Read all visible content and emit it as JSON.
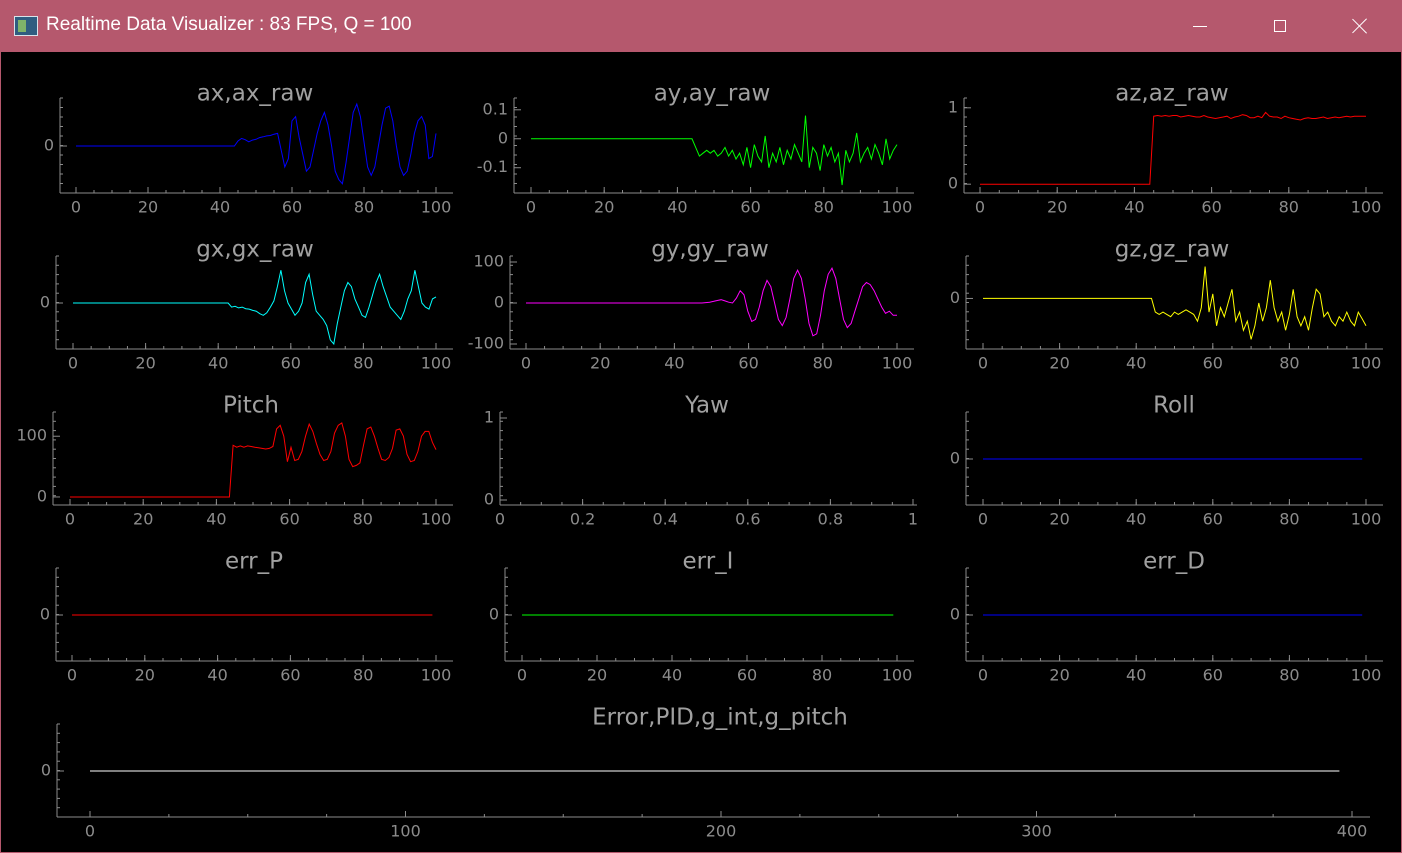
{
  "window": {
    "title": "Realtime Data Visualizer : 83 FPS, Q = 100",
    "icon": "app-chart-icon",
    "controls": [
      "minimize-icon",
      "maximize-icon",
      "close-icon"
    ]
  },
  "colors": {
    "background": "#000000",
    "titlebar": "#b5586d",
    "axis": "#8c8c8c",
    "title_text": "#a0a0a0"
  },
  "chart_data": [
    {
      "id": "ax",
      "type": "line",
      "title": "ax,ax_raw",
      "xlim": [
        0,
        100
      ],
      "ylim": [
        -1,
        1
      ],
      "xticks": [
        0,
        20,
        40,
        60,
        80,
        100
      ],
      "yticks": [
        0
      ],
      "series": [
        {
          "color": "#0000ff",
          "values": [
            0,
            0,
            0,
            0,
            0,
            0,
            0,
            0,
            0,
            0,
            0,
            0,
            0,
            0,
            0,
            0,
            0,
            0,
            0,
            0,
            0,
            0,
            0,
            0,
            0,
            0,
            0,
            0,
            0,
            0,
            0,
            0,
            0,
            0,
            0,
            0,
            0,
            0,
            0,
            0,
            0,
            0,
            0,
            0,
            0,
            0.12,
            0.18,
            0.15,
            0.1,
            0.14,
            0.16,
            0.2,
            0.22,
            0.24,
            0.25,
            0.28,
            0.3,
            -0.1,
            -0.5,
            -0.3,
            0.6,
            0.7,
            0.2,
            -0.2,
            -0.6,
            -0.5,
            -0.1,
            0.3,
            0.6,
            0.8,
            0.5,
            0,
            -0.6,
            -0.8,
            -0.9,
            -0.4,
            0.2,
            0.8,
            1.0,
            0.7,
            0.1,
            -0.5,
            -0.7,
            -0.5,
            0,
            0.5,
            0.9,
            0.95,
            0.6,
            0,
            -0.5,
            -0.7,
            -0.6,
            -0.2,
            0.3,
            0.6,
            0.7,
            0.5,
            -0.3,
            -0.25,
            0.3
          ]
        }
      ]
    },
    {
      "id": "ay",
      "type": "line",
      "title": "ay,ay_raw",
      "xlim": [
        0,
        100
      ],
      "ylim": [
        -0.17,
        0.12
      ],
      "xticks": [
        0,
        20,
        40,
        60,
        80,
        100
      ],
      "yticks": [
        0.1,
        0,
        -0.1
      ],
      "ytick_labels": [
        "0.1",
        "0",
        "-0.1"
      ],
      "series": [
        {
          "color": "#00ff00",
          "values": [
            0,
            0,
            0,
            0,
            0,
            0,
            0,
            0,
            0,
            0,
            0,
            0,
            0,
            0,
            0,
            0,
            0,
            0,
            0,
            0,
            0,
            0,
            0,
            0,
            0,
            0,
            0,
            0,
            0,
            0,
            0,
            0,
            0,
            0,
            0,
            0,
            0,
            0,
            0,
            0,
            0,
            0,
            0,
            0,
            0,
            -0.03,
            -0.06,
            -0.05,
            -0.04,
            -0.05,
            -0.04,
            -0.06,
            -0.05,
            -0.03,
            -0.06,
            -0.04,
            -0.07,
            -0.05,
            -0.09,
            -0.03,
            -0.1,
            -0.02,
            -0.06,
            -0.08,
            0.01,
            -0.1,
            -0.05,
            -0.08,
            -0.03,
            -0.09,
            -0.04,
            -0.07,
            -0.02,
            -0.05,
            -0.08,
            0.08,
            -0.1,
            -0.03,
            -0.05,
            -0.11,
            -0.02,
            -0.06,
            -0.03,
            -0.08,
            -0.05,
            -0.16,
            -0.04,
            -0.08,
            -0.05,
            0.02,
            -0.08,
            -0.05,
            -0.03,
            -0.07,
            -0.02,
            -0.05,
            -0.09,
            0,
            -0.07,
            -0.04,
            -0.02
          ]
        }
      ]
    },
    {
      "id": "az",
      "type": "line",
      "title": "az,az_raw",
      "xlim": [
        0,
        100
      ],
      "ylim": [
        -0.05,
        1.05
      ],
      "xticks": [
        0,
        20,
        40,
        60,
        80,
        100
      ],
      "yticks": [
        1,
        0
      ],
      "series": [
        {
          "color": "#ff0000",
          "values": [
            0,
            0,
            0,
            0,
            0,
            0,
            0,
            0,
            0,
            0,
            0,
            0,
            0,
            0,
            0,
            0,
            0,
            0,
            0,
            0,
            0,
            0,
            0,
            0,
            0,
            0,
            0,
            0,
            0,
            0,
            0,
            0,
            0,
            0,
            0,
            0,
            0,
            0,
            0,
            0,
            0,
            0,
            0,
            0,
            0,
            0.89,
            0.9,
            0.89,
            0.9,
            0.89,
            0.9,
            0.9,
            0.88,
            0.89,
            0.9,
            0.89,
            0.88,
            0.88,
            0.9,
            0.88,
            0.87,
            0.86,
            0.87,
            0.88,
            0.89,
            0.86,
            0.88,
            0.89,
            0.91,
            0.9,
            0.87,
            0.87,
            0.89,
            0.87,
            0.94,
            0.89,
            0.88,
            0.88,
            0.86,
            0.89,
            0.87,
            0.86,
            0.85,
            0.84,
            0.86,
            0.87,
            0.86,
            0.86,
            0.87,
            0.88,
            0.86,
            0.87,
            0.88,
            0.87,
            0.88,
            0.89,
            0.88,
            0.89,
            0.89,
            0.89,
            0.89
          ]
        }
      ]
    },
    {
      "id": "gx",
      "type": "line",
      "title": "gx,gx_raw",
      "xlim": [
        0,
        100
      ],
      "ylim": [
        -1,
        1
      ],
      "xticks": [
        0,
        20,
        40,
        60,
        80,
        100
      ],
      "yticks": [
        0
      ],
      "series": [
        {
          "color": "#00ffff",
          "values": [
            0,
            0,
            0,
            0,
            0,
            0,
            0,
            0,
            0,
            0,
            0,
            0,
            0,
            0,
            0,
            0,
            0,
            0,
            0,
            0,
            0,
            0,
            0,
            0,
            0,
            0,
            0,
            0,
            0,
            0,
            0,
            0,
            0,
            0,
            0,
            0,
            0,
            0,
            0,
            0,
            0,
            0,
            0,
            0,
            0,
            -0.1,
            -0.08,
            -0.12,
            -0.1,
            -0.14,
            -0.15,
            -0.18,
            -0.2,
            -0.26,
            -0.3,
            -0.24,
            -0.1,
            0.05,
            0.4,
            0.8,
            0.3,
            0,
            -0.15,
            -0.3,
            -0.2,
            0,
            0.5,
            0.7,
            0.2,
            -0.2,
            -0.3,
            -0.4,
            -0.55,
            -0.9,
            -1.0,
            -0.5,
            -0.1,
            0.3,
            0.5,
            0.4,
            0.1,
            -0.1,
            -0.3,
            -0.35,
            -0.1,
            0.2,
            0.5,
            0.7,
            0.4,
            0.15,
            -0.1,
            -0.2,
            -0.3,
            -0.4,
            -0.2,
            0.1,
            0.3,
            0.8,
            0.4,
            0,
            -0.1,
            -0.15,
            0.1,
            0.15
          ]
        }
      ]
    },
    {
      "id": "gy",
      "type": "line",
      "title": "gy,gy_raw",
      "xlim": [
        0,
        100
      ],
      "ylim": [
        -100,
        100
      ],
      "xticks": [
        0,
        20,
        40,
        60,
        80,
        100
      ],
      "yticks": [
        100,
        0,
        -100
      ],
      "series": [
        {
          "color": "#ff00ff",
          "values": [
            0,
            0,
            0,
            0,
            0,
            0,
            0,
            0,
            0,
            0,
            0,
            0,
            0,
            0,
            0,
            0,
            0,
            0,
            0,
            0,
            0,
            0,
            0,
            0,
            0,
            0,
            0,
            0,
            0,
            0,
            0,
            0,
            0,
            0,
            0,
            0,
            0,
            0,
            0,
            0,
            0,
            0,
            0,
            0,
            0,
            0,
            0,
            1,
            2,
            4,
            6,
            8,
            5,
            2,
            0,
            12,
            30,
            20,
            -20,
            -45,
            -40,
            -10,
            30,
            55,
            40,
            0,
            -40,
            -55,
            -35,
            10,
            60,
            80,
            60,
            10,
            -50,
            -80,
            -75,
            -30,
            30,
            70,
            85,
            60,
            10,
            -40,
            -60,
            -50,
            -20,
            10,
            40,
            50,
            45,
            30,
            10,
            -10,
            -25,
            -20,
            -30,
            -30
          ]
        }
      ]
    },
    {
      "id": "gz",
      "type": "line",
      "title": "gz,gz_raw",
      "xlim": [
        0,
        100
      ],
      "ylim": [
        -1,
        0.8
      ],
      "xticks": [
        0,
        20,
        40,
        60,
        80,
        100
      ],
      "yticks": [
        0
      ],
      "series": [
        {
          "color": "#ffff00",
          "values": [
            0,
            0,
            0,
            0,
            0,
            0,
            0,
            0,
            0,
            0,
            0,
            0,
            0,
            0,
            0,
            0,
            0,
            0,
            0,
            0,
            0,
            0,
            0,
            0,
            0,
            0,
            0,
            0,
            0,
            0,
            0,
            0,
            0,
            0,
            0,
            0,
            0,
            0,
            0,
            0,
            0,
            0,
            0,
            0,
            0,
            -0.3,
            -0.35,
            -0.3,
            -0.35,
            -0.4,
            -0.3,
            -0.35,
            -0.3,
            -0.25,
            -0.3,
            -0.35,
            -0.5,
            -0.2,
            0.7,
            -0.3,
            0.1,
            -0.6,
            -0.2,
            -0.4,
            -0.1,
            0.2,
            -0.5,
            -0.3,
            -0.7,
            -0.5,
            -0.9,
            -0.6,
            -0.1,
            -0.5,
            -0.2,
            0.4,
            -0.2,
            -0.5,
            -0.3,
            -0.7,
            -0.35,
            0.2,
            -0.4,
            -0.6,
            -0.4,
            -0.7,
            -0.2,
            0.2,
            0.1,
            -0.4,
            -0.3,
            -0.5,
            -0.6,
            -0.4,
            -0.5,
            -0.3,
            -0.5,
            -0.6,
            -0.3,
            -0.45,
            -0.6
          ]
        }
      ]
    },
    {
      "id": "pitch",
      "type": "line",
      "title": "Pitch",
      "xlim": [
        0,
        100
      ],
      "ylim": [
        -5,
        130
      ],
      "xticks": [
        0,
        20,
        40,
        60,
        80,
        100
      ],
      "yticks": [
        100,
        0
      ],
      "series": [
        {
          "color": "#ff0000",
          "values": [
            0,
            0,
            0,
            0,
            0,
            0,
            0,
            0,
            0,
            0,
            0,
            0,
            0,
            0,
            0,
            0,
            0,
            0,
            0,
            0,
            0,
            0,
            0,
            0,
            0,
            0,
            0,
            0,
            0,
            0,
            0,
            0,
            0,
            0,
            0,
            0,
            0,
            0,
            0,
            0,
            0,
            0,
            0,
            0,
            0,
            85,
            82,
            84,
            82,
            84,
            83,
            82,
            81,
            80,
            79,
            80,
            83,
            112,
            118,
            100,
            58,
            82,
            60,
            62,
            75,
            100,
            120,
            108,
            88,
            70,
            60,
            62,
            75,
            105,
            118,
            122,
            100,
            62,
            50,
            52,
            56,
            85,
            112,
            115,
            100,
            80,
            62,
            60,
            65,
            80,
            110,
            112,
            100,
            70,
            58,
            60,
            75,
            100,
            108,
            108,
            90,
            78
          ]
        }
      ]
    },
    {
      "id": "yaw",
      "type": "line",
      "title": "Yaw",
      "xlim": [
        0,
        1
      ],
      "ylim": [
        0,
        1
      ],
      "xticks": [
        0,
        0.2,
        0.4,
        0.6,
        0.8,
        1
      ],
      "xtick_labels": [
        "0",
        "0.2",
        "0.4",
        "0.6",
        "0.8",
        "1"
      ],
      "yticks": [
        1,
        0
      ],
      "series": []
    },
    {
      "id": "roll",
      "type": "line",
      "title": "Roll",
      "xlim": [
        0,
        100
      ],
      "ylim": [
        -1,
        1
      ],
      "xticks": [
        0,
        20,
        40,
        60,
        80,
        100
      ],
      "yticks": [
        0
      ],
      "series": [
        {
          "color": "#0000ff",
          "constant": 0
        }
      ]
    },
    {
      "id": "errp",
      "type": "line",
      "title": "err_P",
      "xlim": [
        0,
        100
      ],
      "ylim": [
        -1,
        1
      ],
      "xticks": [
        0,
        20,
        40,
        60,
        80,
        100
      ],
      "yticks": [
        0
      ],
      "series": [
        {
          "color": "#ff0000",
          "constant": 0
        }
      ]
    },
    {
      "id": "erri",
      "type": "line",
      "title": "err_I",
      "xlim": [
        0,
        100
      ],
      "ylim": [
        -1,
        1
      ],
      "xticks": [
        0,
        20,
        40,
        60,
        80,
        100
      ],
      "yticks": [
        0
      ],
      "series": [
        {
          "color": "#00ff00",
          "constant": 0
        }
      ]
    },
    {
      "id": "errd",
      "type": "line",
      "title": "err_D",
      "xlim": [
        0,
        100
      ],
      "ylim": [
        -1,
        1
      ],
      "xticks": [
        0,
        20,
        40,
        60,
        80,
        100
      ],
      "yticks": [
        0
      ],
      "series": [
        {
          "color": "#0000ff",
          "constant": 0
        }
      ]
    },
    {
      "id": "error",
      "type": "line",
      "title": "Error,PID,g_int,g_pitch",
      "xlim": [
        0,
        400
      ],
      "ylim": [
        -1,
        1
      ],
      "xticks": [
        0,
        100,
        200,
        300,
        400
      ],
      "yticks": [
        0
      ],
      "series": [
        {
          "color": "#ffffff",
          "constant": 0
        }
      ]
    }
  ]
}
